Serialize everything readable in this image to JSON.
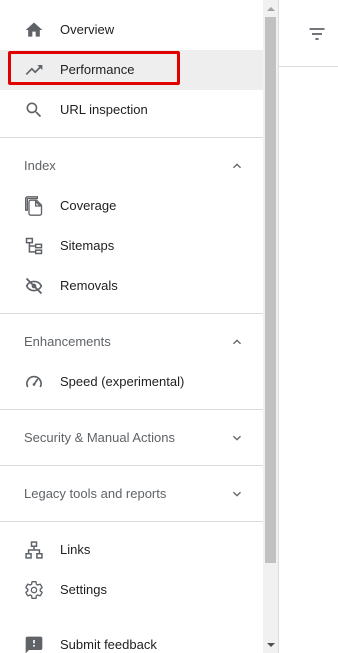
{
  "nav": {
    "overview": "Overview",
    "performance": "Performance",
    "url_inspection": "URL inspection",
    "index_section": "Index",
    "coverage": "Coverage",
    "sitemaps": "Sitemaps",
    "removals": "Removals",
    "enhancements_section": "Enhancements",
    "speed": "Speed (experimental)",
    "security_section": "Security & Manual Actions",
    "legacy_section": "Legacy tools and reports",
    "links": "Links",
    "settings": "Settings",
    "submit_feedback": "Submit feedback"
  },
  "icons": {
    "overview": "home-icon",
    "performance": "trending-up-icon",
    "url_inspection": "search-icon",
    "coverage": "copy-icon",
    "sitemaps": "sitemap-icon",
    "removals": "visibility-off-icon",
    "speed": "speedometer-icon",
    "links": "links-icon",
    "settings": "gear-icon",
    "submit_feedback": "feedback-icon",
    "filter": "filter-icon"
  },
  "colors": {
    "highlight": "#e00000",
    "selected_bg": "#eeeeee",
    "divider": "#dadce0",
    "icon": "#5f6368",
    "section_text": "#5f6368"
  }
}
